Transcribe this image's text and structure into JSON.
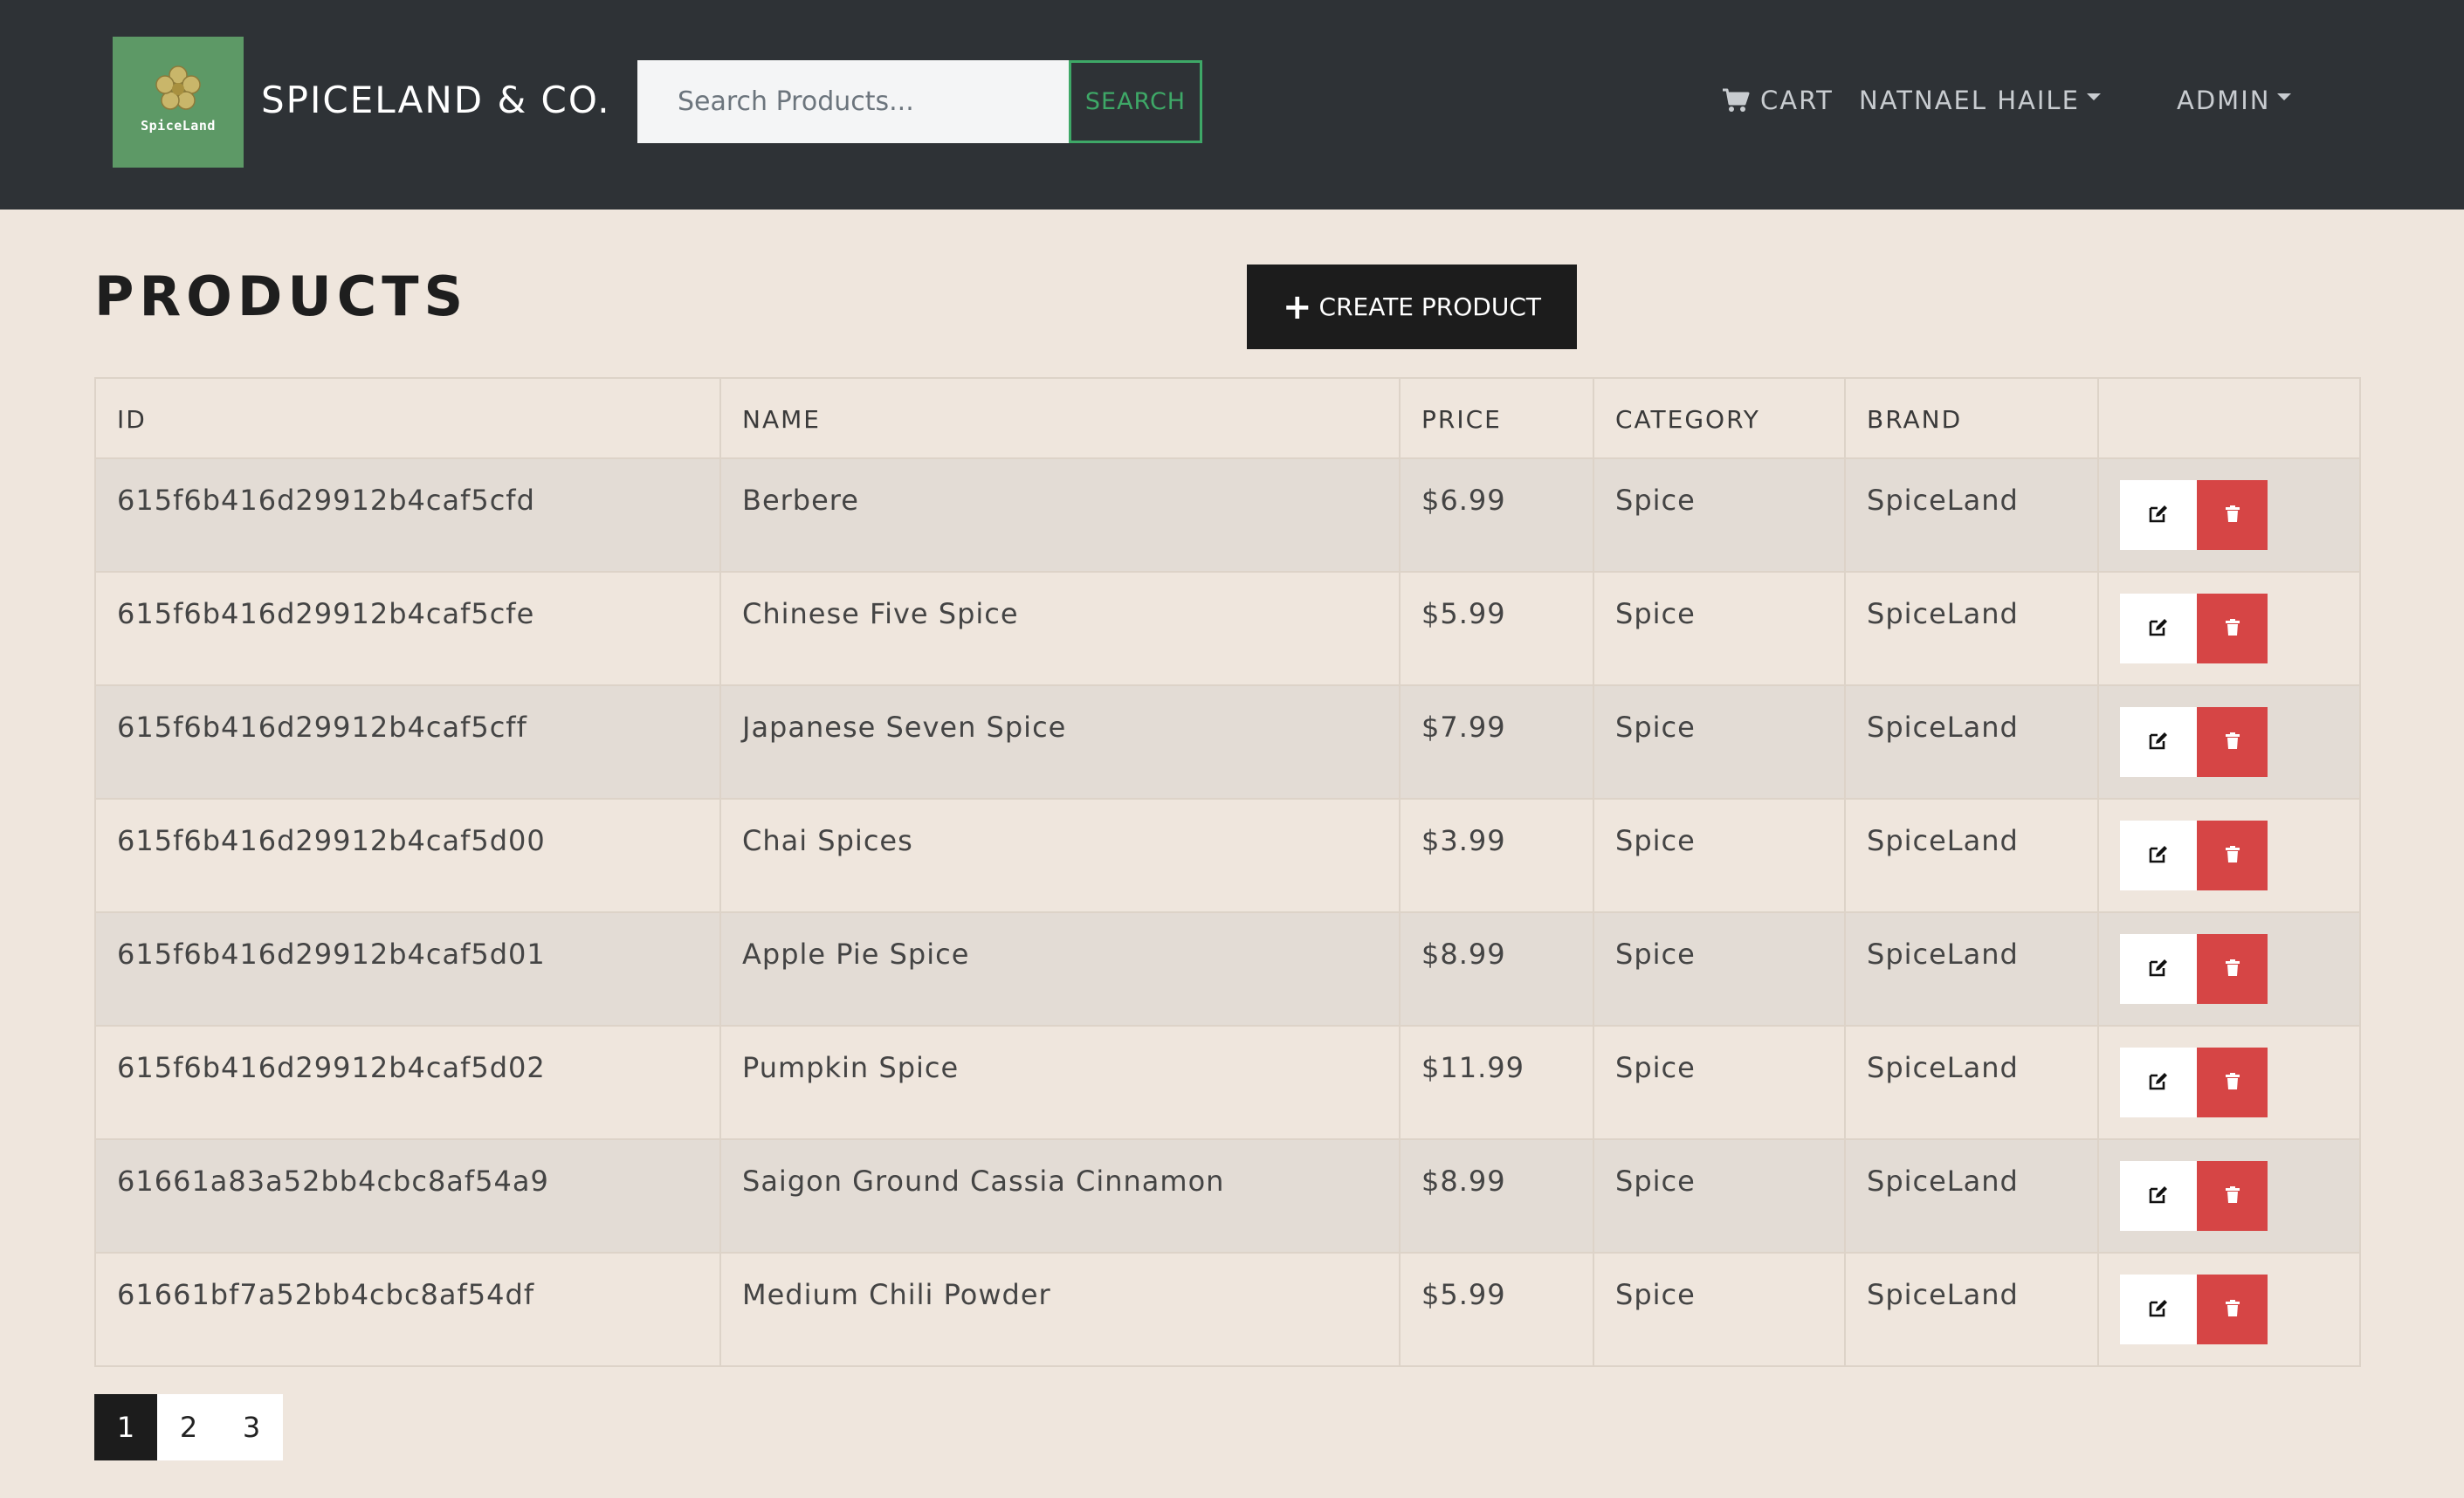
{
  "navbar": {
    "logo_text": "SpiceLand",
    "brand": "SPICELAND & CO.",
    "search_placeholder": "Search Products...",
    "search_label": "SEARCH",
    "cart_label": "CART",
    "user_label": "NATNAEL HAILE",
    "admin_label": "ADMIN"
  },
  "page": {
    "title": "PRODUCTS",
    "create_label": "CREATE PRODUCT"
  },
  "table": {
    "headers": [
      "ID",
      "NAME",
      "PRICE",
      "CATEGORY",
      "BRAND",
      ""
    ],
    "rows": [
      {
        "id": "615f6b416d29912b4caf5cfd",
        "name": "Berbere",
        "price": "$6.99",
        "category": "Spice",
        "brand": "SpiceLand"
      },
      {
        "id": "615f6b416d29912b4caf5cfe",
        "name": "Chinese Five Spice",
        "price": "$5.99",
        "category": "Spice",
        "brand": "SpiceLand"
      },
      {
        "id": "615f6b416d29912b4caf5cff",
        "name": "Japanese Seven Spice",
        "price": "$7.99",
        "category": "Spice",
        "brand": "SpiceLand"
      },
      {
        "id": "615f6b416d29912b4caf5d00",
        "name": "Chai Spices",
        "price": "$3.99",
        "category": "Spice",
        "brand": "SpiceLand"
      },
      {
        "id": "615f6b416d29912b4caf5d01",
        "name": "Apple Pie Spice",
        "price": "$8.99",
        "category": "Spice",
        "brand": "SpiceLand"
      },
      {
        "id": "615f6b416d29912b4caf5d02",
        "name": "Pumpkin Spice",
        "price": "$11.99",
        "category": "Spice",
        "brand": "SpiceLand"
      },
      {
        "id": "61661a83a52bb4cbc8af54a9",
        "name": "Saigon Ground Cassia Cinnamon",
        "price": "$8.99",
        "category": "Spice",
        "brand": "SpiceLand"
      },
      {
        "id": "61661bf7a52bb4cbc8af54df",
        "name": "Medium Chili Powder",
        "price": "$5.99",
        "category": "Spice",
        "brand": "SpiceLand"
      }
    ]
  },
  "pagination": {
    "pages": [
      "1",
      "2",
      "3"
    ],
    "active": "1"
  },
  "icons": {
    "cart": "cart-icon",
    "edit": "edit-icon",
    "delete": "trash-icon",
    "plus": "plus-icon",
    "logo": "flower-icon"
  },
  "colors": {
    "navbar_bg": "#2e3236",
    "page_bg": "#efe6dd",
    "logo_bg": "#5d9966",
    "search_accent": "#3ea867",
    "delete_red": "#d64545",
    "dark_button": "#1c1c1c"
  }
}
